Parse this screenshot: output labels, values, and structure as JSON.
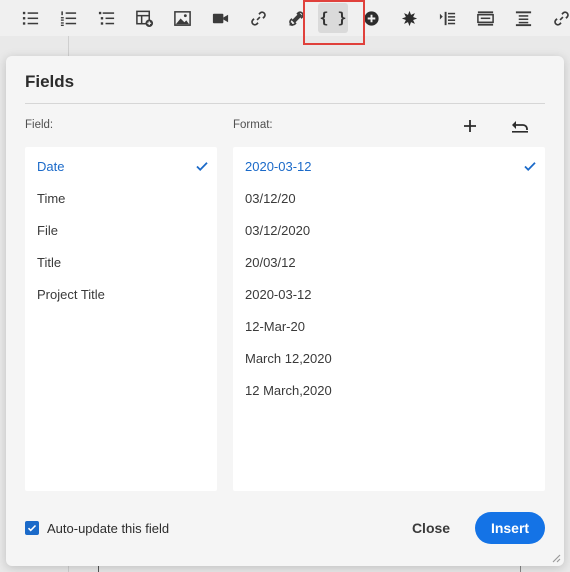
{
  "toolbar": {
    "buttons": [
      {
        "name": "bullet-list-icon"
      },
      {
        "name": "numbered-list-icon"
      },
      {
        "name": "checklist-icon"
      },
      {
        "name": "insert-table-icon"
      },
      {
        "name": "insert-image-icon"
      },
      {
        "name": "insert-video-icon"
      },
      {
        "name": "insert-link-icon"
      },
      {
        "name": "unlink-icon"
      },
      {
        "name": "insert-field-icon",
        "glyph": "{ }",
        "selected": true
      },
      {
        "name": "add-circle-icon"
      },
      {
        "name": "star-burst-icon"
      },
      {
        "name": "indent-icon"
      },
      {
        "name": "layout-icon"
      },
      {
        "name": "align-icon"
      },
      {
        "name": "chain-icon"
      }
    ]
  },
  "dialog": {
    "title": "Fields",
    "field_label": "Field:",
    "format_label": "Format:",
    "fields": [
      {
        "label": "Date",
        "selected": true
      },
      {
        "label": "Time"
      },
      {
        "label": "File"
      },
      {
        "label": "Title"
      },
      {
        "label": "Project Title"
      }
    ],
    "formats": [
      {
        "label": "2020-03-12",
        "selected": true
      },
      {
        "label": "03/12/20"
      },
      {
        "label": "03/12/2020"
      },
      {
        "label": "20/03/12"
      },
      {
        "label": "2020-03-12"
      },
      {
        "label": "12-Mar-20"
      },
      {
        "label": "March 12,2020"
      },
      {
        "label": "12 March,2020"
      }
    ],
    "auto_update_label": "Auto-update this field",
    "auto_update_checked": true,
    "close_label": "Close",
    "insert_label": "Insert"
  },
  "colors": {
    "accent": "#1473e6",
    "selected_text": "#1b6ac9",
    "highlight": "#e0413c"
  }
}
